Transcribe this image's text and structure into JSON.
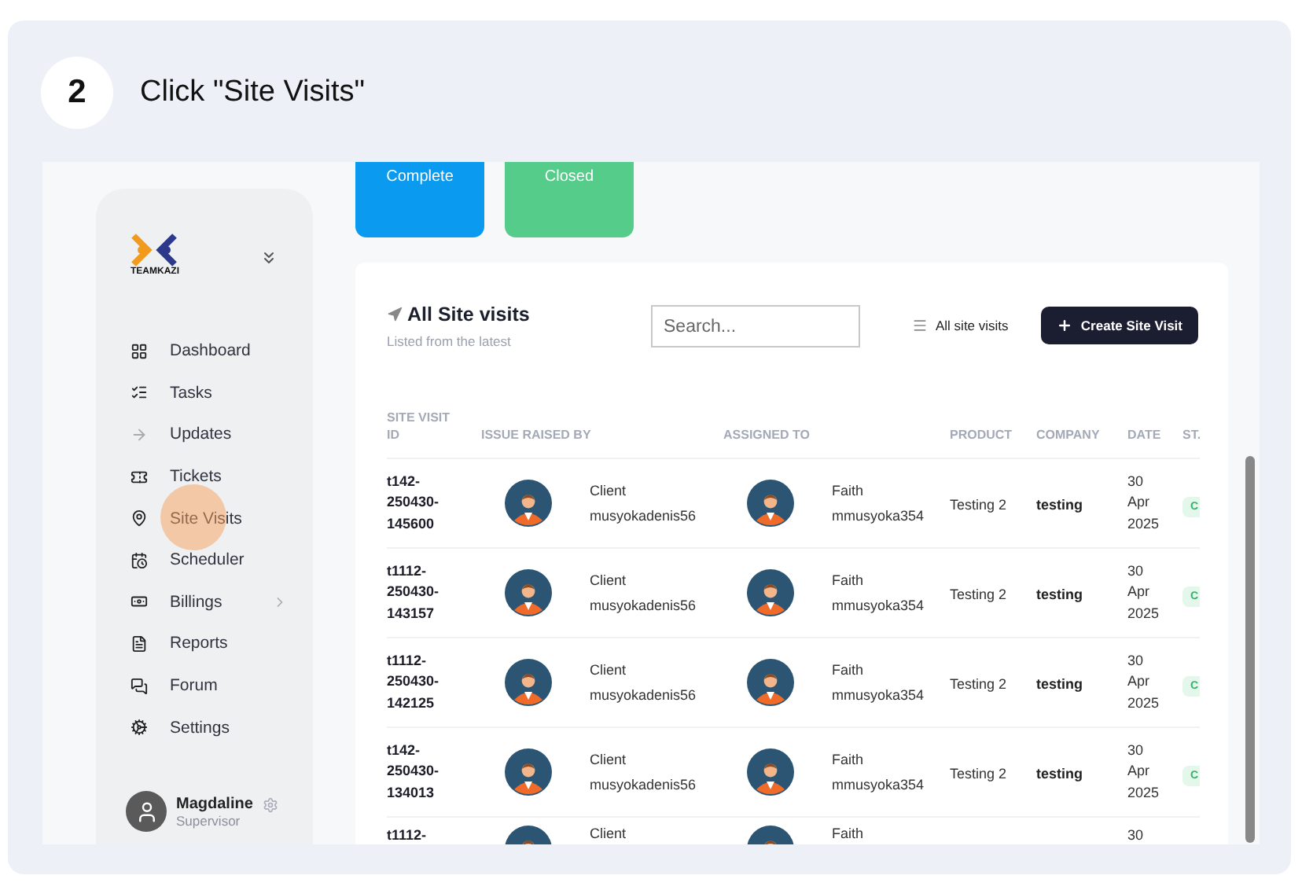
{
  "step": {
    "number": "2",
    "instruction": "Click \"Site Visits\""
  },
  "status_cards": [
    {
      "label": "Complete",
      "color": "#0a9bf0"
    },
    {
      "label": "Closed",
      "color": "#55cc8a"
    }
  ],
  "sidebar": {
    "logo_text": "TEAMKAZI",
    "items": [
      {
        "label": "Dashboard",
        "has_submenu": false,
        "click_target": false
      },
      {
        "label": "Tasks",
        "has_submenu": false,
        "click_target": false
      },
      {
        "label": "Updates",
        "has_submenu": false,
        "click_target": false
      },
      {
        "label": "Tickets",
        "has_submenu": false,
        "click_target": false
      },
      {
        "label": "Site Visits",
        "has_submenu": false,
        "click_target": true
      },
      {
        "label": "Scheduler",
        "has_submenu": false,
        "click_target": false
      },
      {
        "label": "Billings",
        "has_submenu": true,
        "click_target": false
      },
      {
        "label": "Reports",
        "has_submenu": false,
        "click_target": false
      },
      {
        "label": "Forum",
        "has_submenu": false,
        "click_target": false
      },
      {
        "label": "Settings",
        "has_submenu": false,
        "click_target": false
      }
    ],
    "user": {
      "name": "Magdaline",
      "role": "Supervisor"
    }
  },
  "panel": {
    "title": "All Site visits",
    "subtitle": "Listed from the latest",
    "search": {
      "placeholder": "Search..."
    },
    "filter": "All site visits",
    "create_button": "Create Site Visit"
  },
  "table": {
    "columns": [
      "SITE VISIT ID",
      "ISSUE RAISED BY",
      "ASSIGNED TO",
      "PRODUCT",
      "COMPANY",
      "DATE",
      "ST."
    ],
    "rows": [
      {
        "id": "t142-250430-145600",
        "raised_name": "Client",
        "raised_email": "musyokadenis56",
        "assigned_name": "Faith",
        "assigned_email": "mmusyoka354",
        "product": "Testing 2",
        "company": "testing",
        "date": "30 Apr 2025",
        "status": "C"
      },
      {
        "id": "t1112-250430-143157",
        "raised_name": "Client",
        "raised_email": "musyokadenis56",
        "assigned_name": "Faith",
        "assigned_email": "mmusyoka354",
        "product": "Testing 2",
        "company": "testing",
        "date": "30 Apr 2025",
        "status": "C"
      },
      {
        "id": "t1112-250430-142125",
        "raised_name": "Client",
        "raised_email": "musyokadenis56",
        "assigned_name": "Faith",
        "assigned_email": "mmusyoka354",
        "product": "Testing 2",
        "company": "testing",
        "date": "30 Apr 2025",
        "status": "C"
      },
      {
        "id": "t142-250430-134013",
        "raised_name": "Client",
        "raised_email": "musyokadenis56",
        "assigned_name": "Faith",
        "assigned_email": "mmusyoka354",
        "product": "Testing 2",
        "company": "testing",
        "date": "30 Apr 2025",
        "status": "C"
      },
      {
        "id": "t1112-",
        "raised_name": "Client",
        "assigned_name": "Faith",
        "date": "30"
      }
    ]
  }
}
